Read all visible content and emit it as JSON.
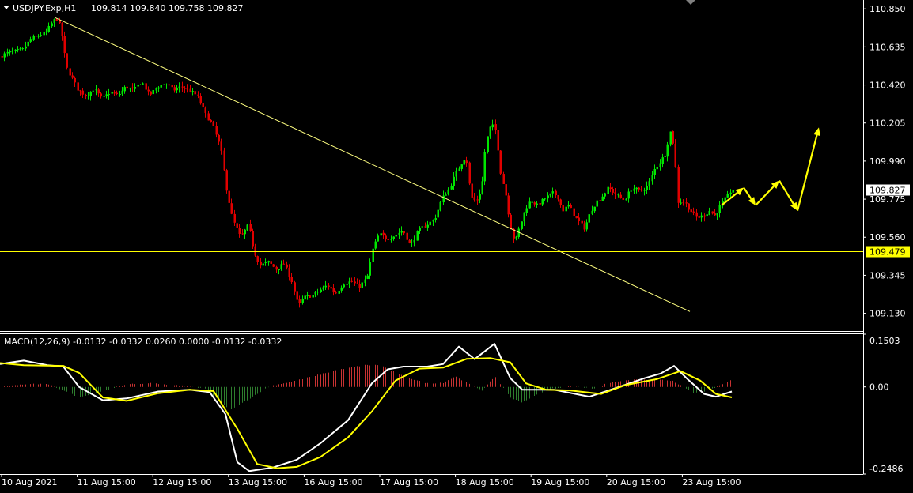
{
  "header": {
    "symbol_info": "USDJPY.Exp,H1",
    "ohlc": "109.814 109.840 109.758 109.827"
  },
  "macd_header": "MACD(12,26,9) -0.0132 -0.0332 0.0260 0.0000 -0.0132 -0.0332",
  "colors": {
    "background": "#000000",
    "bull": "#00E600",
    "bear": "#E00000",
    "trend_line": "#FFFF80",
    "support_line": "#FFFF00",
    "bid_line": "#8090B0",
    "arrow": "#FFFF00",
    "macd_main": "#FFFFFF",
    "macd_signal": "#FFFF00",
    "hist_pos": "#C83232",
    "hist_neg": "#2E7D2E",
    "text": "#FFFFFF",
    "border": "#FFFFFF"
  },
  "chart_data": [
    {
      "type": "candlestick",
      "panel": "price",
      "ylim": [
        109.03,
        110.9
      ],
      "y_ticks": [
        "110.850",
        "110.635",
        "110.420",
        "110.205",
        "109.990",
        "109.775",
        "109.560",
        "109.345",
        "109.130"
      ],
      "x_ticks": [
        "10 Aug 2021",
        "11 Aug 15:00",
        "12 Aug 15:00",
        "13 Aug 15:00",
        "16 Aug 15:00",
        "17 Aug 15:00",
        "18 Aug 15:00",
        "19 Aug 15:00",
        "20 Aug 15:00",
        "23 Aug 15:00"
      ],
      "price_path": [
        [
          0,
          110.58
        ],
        [
          10,
          110.6
        ],
        [
          20,
          110.61
        ],
        [
          30,
          110.62
        ],
        [
          40,
          110.68
        ],
        [
          50,
          110.7
        ],
        [
          60,
          110.72
        ],
        [
          65,
          110.76
        ],
        [
          72,
          110.8
        ],
        [
          78,
          110.74
        ],
        [
          85,
          110.52
        ],
        [
          92,
          110.46
        ],
        [
          100,
          110.39
        ],
        [
          110,
          110.36
        ],
        [
          120,
          110.4
        ],
        [
          130,
          110.34
        ],
        [
          140,
          110.38
        ],
        [
          150,
          110.36
        ],
        [
          160,
          110.41
        ],
        [
          170,
          110.39
        ],
        [
          180,
          110.44
        ],
        [
          190,
          110.36
        ],
        [
          200,
          110.41
        ],
        [
          210,
          110.43
        ],
        [
          220,
          110.39
        ],
        [
          230,
          110.41
        ],
        [
          240,
          110.39
        ],
        [
          250,
          110.36
        ],
        [
          260,
          110.26
        ],
        [
          270,
          110.19
        ],
        [
          280,
          110.06
        ],
        [
          287,
          109.84
        ],
        [
          295,
          109.66
        ],
        [
          305,
          109.56
        ],
        [
          315,
          109.63
        ],
        [
          322,
          109.48
        ],
        [
          330,
          109.4
        ],
        [
          340,
          109.42
        ],
        [
          350,
          109.38
        ],
        [
          360,
          109.41
        ],
        [
          370,
          109.31
        ],
        [
          378,
          109.17
        ],
        [
          385,
          109.22
        ],
        [
          395,
          109.23
        ],
        [
          405,
          109.26
        ],
        [
          415,
          109.29
        ],
        [
          425,
          109.24
        ],
        [
          435,
          109.3
        ],
        [
          445,
          109.31
        ],
        [
          455,
          109.28
        ],
        [
          465,
          109.33
        ],
        [
          472,
          109.49
        ],
        [
          480,
          109.58
        ],
        [
          490,
          109.55
        ],
        [
          500,
          109.57
        ],
        [
          510,
          109.6
        ],
        [
          520,
          109.51
        ],
        [
          530,
          109.6
        ],
        [
          540,
          109.63
        ],
        [
          550,
          109.66
        ],
        [
          560,
          109.78
        ],
        [
          568,
          109.83
        ],
        [
          575,
          109.9
        ],
        [
          583,
          109.97
        ],
        [
          590,
          110.02
        ],
        [
          596,
          109.79
        ],
        [
          603,
          109.76
        ],
        [
          610,
          109.84
        ],
        [
          615,
          110.09
        ],
        [
          622,
          110.2
        ],
        [
          628,
          110.16
        ],
        [
          634,
          109.92
        ],
        [
          640,
          109.81
        ],
        [
          646,
          109.63
        ],
        [
          652,
          109.53
        ],
        [
          658,
          109.62
        ],
        [
          665,
          109.72
        ],
        [
          672,
          109.77
        ],
        [
          680,
          109.74
        ],
        [
          690,
          109.78
        ],
        [
          700,
          109.81
        ],
        [
          706,
          109.79
        ],
        [
          712,
          109.71
        ],
        [
          720,
          109.74
        ],
        [
          730,
          109.66
        ],
        [
          740,
          109.61
        ],
        [
          748,
          109.71
        ],
        [
          755,
          109.76
        ],
        [
          762,
          109.79
        ],
        [
          770,
          109.84
        ],
        [
          780,
          109.8
        ],
        [
          790,
          109.77
        ],
        [
          800,
          109.84
        ],
        [
          810,
          109.82
        ],
        [
          820,
          109.85
        ],
        [
          828,
          109.94
        ],
        [
          836,
          109.99
        ],
        [
          842,
          110.03
        ],
        [
          848,
          110.16
        ],
        [
          853,
          110.07
        ],
        [
          858,
          109.76
        ],
        [
          866,
          109.76
        ],
        [
          874,
          109.71
        ],
        [
          882,
          109.67
        ],
        [
          890,
          109.68
        ],
        [
          898,
          109.71
        ],
        [
          904,
          109.68
        ],
        [
          912,
          109.74
        ],
        [
          920,
          109.79
        ],
        [
          926,
          109.83
        ]
      ]
    },
    {
      "type": "line",
      "panel": "macd",
      "ylim": [
        -0.2486,
        0.1503
      ],
      "y_ticks": [
        "0.1503",
        "0.00",
        "-0.2486"
      ],
      "series": [
        {
          "name": "main",
          "values": [
            [
              0,
              0.065
            ],
            [
              30,
              0.075
            ],
            [
              60,
              0.062
            ],
            [
              80,
              0.058
            ],
            [
              100,
              0.0
            ],
            [
              130,
              -0.038
            ],
            [
              160,
              -0.033
            ],
            [
              200,
              -0.013
            ],
            [
              240,
              -0.008
            ],
            [
              265,
              -0.015
            ],
            [
              285,
              -0.078
            ],
            [
              300,
              -0.215
            ],
            [
              315,
              -0.24
            ],
            [
              345,
              -0.23
            ],
            [
              375,
              -0.208
            ],
            [
              405,
              -0.161
            ],
            [
              440,
              -0.095
            ],
            [
              470,
              0.01
            ],
            [
              490,
              0.05
            ],
            [
              510,
              0.058
            ],
            [
              540,
              0.058
            ],
            [
              560,
              0.065
            ],
            [
              580,
              0.115
            ],
            [
              600,
              0.079
            ],
            [
              625,
              0.123
            ],
            [
              645,
              0.025
            ],
            [
              660,
              -0.008
            ],
            [
              700,
              -0.008
            ],
            [
              745,
              -0.028
            ],
            [
              780,
              -0.002
            ],
            [
              815,
              0.025
            ],
            [
              835,
              0.038
            ],
            [
              852,
              0.06
            ],
            [
              870,
              0.02
            ],
            [
              890,
              -0.02
            ],
            [
              905,
              -0.028
            ],
            [
              925,
              -0.013
            ]
          ]
        },
        {
          "name": "signal",
          "values": [
            [
              0,
              0.068
            ],
            [
              30,
              0.062
            ],
            [
              80,
              0.06
            ],
            [
              100,
              0.04
            ],
            [
              130,
              -0.03
            ],
            [
              160,
              -0.04
            ],
            [
              200,
              -0.018
            ],
            [
              240,
              -0.008
            ],
            [
              270,
              -0.012
            ],
            [
              300,
              -0.12
            ],
            [
              325,
              -0.22
            ],
            [
              350,
              -0.232
            ],
            [
              375,
              -0.228
            ],
            [
              405,
              -0.2
            ],
            [
              440,
              -0.144
            ],
            [
              470,
              -0.07
            ],
            [
              500,
              0.018
            ],
            [
              530,
              0.052
            ],
            [
              560,
              0.055
            ],
            [
              590,
              0.08
            ],
            [
              620,
              0.082
            ],
            [
              645,
              0.07
            ],
            [
              665,
              0.01
            ],
            [
              690,
              -0.008
            ],
            [
              720,
              -0.01
            ],
            [
              760,
              -0.02
            ],
            [
              790,
              0.005
            ],
            [
              830,
              0.022
            ],
            [
              860,
              0.045
            ],
            [
              885,
              0.018
            ],
            [
              905,
              -0.02
            ],
            [
              925,
              -0.03
            ]
          ]
        }
      ]
    },
    {
      "type": "bar",
      "panel": "macd-histogram",
      "values": [
        [
          0,
          0.0
        ],
        [
          20,
          0.006
        ],
        [
          40,
          0.008
        ],
        [
          60,
          0.008
        ],
        [
          80,
          -0.01
        ],
        [
          100,
          -0.03
        ],
        [
          130,
          -0.012
        ],
        [
          160,
          0.008
        ],
        [
          190,
          0.01
        ],
        [
          220,
          0.005
        ],
        [
          260,
          -0.005
        ],
        [
          290,
          -0.068
        ],
        [
          310,
          -0.04
        ],
        [
          340,
          0.002
        ],
        [
          375,
          0.018
        ],
        [
          420,
          0.045
        ],
        [
          460,
          0.062
        ],
        [
          480,
          0.062
        ],
        [
          510,
          0.03
        ],
        [
          540,
          0.01
        ],
        [
          560,
          0.012
        ],
        [
          575,
          0.03
        ],
        [
          595,
          0.005
        ],
        [
          610,
          -0.01
        ],
        [
          625,
          0.03
        ],
        [
          645,
          -0.03
        ],
        [
          660,
          -0.045
        ],
        [
          690,
          -0.008
        ],
        [
          720,
          0.003
        ],
        [
          750,
          -0.005
        ],
        [
          770,
          0.012
        ],
        [
          800,
          0.02
        ],
        [
          830,
          0.02
        ],
        [
          850,
          0.018
        ],
        [
          875,
          -0.018
        ],
        [
          895,
          -0.01
        ],
        [
          925,
          0.02
        ]
      ]
    }
  ],
  "annotations": {
    "trend_line": {
      "from": [
        70,
        110.8
      ],
      "to": [
        872,
        109.14
      ]
    },
    "support_line": {
      "price": 109.479,
      "label": "109.479"
    },
    "bid_line": {
      "price": 109.827,
      "label": "109.827"
    },
    "forecast_path": [
      [
        912,
        109.74
      ],
      [
        940,
        109.84
      ],
      [
        955,
        109.74
      ],
      [
        985,
        109.88
      ],
      [
        1008,
        109.71
      ],
      [
        1035,
        110.18
      ]
    ]
  }
}
